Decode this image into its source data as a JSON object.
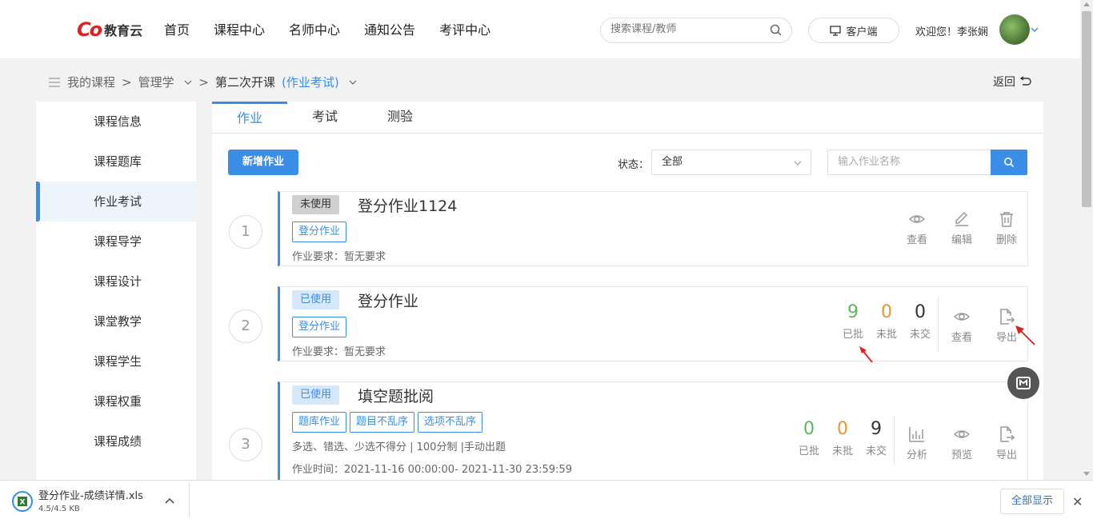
{
  "header": {
    "logo_mark": "Co",
    "logo_text": "教育云",
    "nav": [
      "首页",
      "课程中心",
      "名师中心",
      "通知公告",
      "考评中心"
    ],
    "search_placeholder": "搜索课程/教师",
    "client_label": "客户端",
    "welcome": "欢迎您！李张娴"
  },
  "breadcrumb": {
    "root": "我的课程",
    "sep": ">",
    "course": "管理学",
    "current_prefix": "第二次开课",
    "current_highlight": "(作业考试)"
  },
  "back_label": "返回",
  "sidebar": {
    "items": [
      "课程信息",
      "课程题库",
      "作业考试",
      "课程导学",
      "课程设计",
      "课堂教学",
      "课程学生",
      "课程权重",
      "课程成绩"
    ],
    "active_index": 2
  },
  "tabs": [
    "作业",
    "考试",
    "测验"
  ],
  "toolbar": {
    "add_label": "新增作业",
    "status_label": "状态：",
    "status_value": "全部",
    "name_placeholder": "输入作业名称"
  },
  "assignments": [
    {
      "num": "1",
      "status": "未使用",
      "title": "登分作业1124",
      "tags": [
        "登分作业"
      ],
      "requirement": "作业要求：暂无要求",
      "actions": [
        "查看",
        "编辑",
        "删除"
      ]
    },
    {
      "num": "2",
      "status": "已使用",
      "title": "登分作业",
      "tags": [
        "登分作业"
      ],
      "requirement": "作业要求：暂无要求",
      "stats": [
        {
          "n": "9",
          "label": "已批",
          "color": "#5cb85c"
        },
        {
          "n": "0",
          "label": "未批",
          "color": "#e6962e"
        },
        {
          "n": "0",
          "label": "未交",
          "color": "#333333"
        }
      ],
      "actions": [
        "查看",
        "导出"
      ]
    },
    {
      "num": "3",
      "status": "已使用",
      "title": "填空题批阅",
      "tags": [
        "题库作业",
        "题目不乱序",
        "选项不乱序"
      ],
      "info": "多选、错选、少选不得分 | 100分制 |手动出题",
      "time": "作业时间：2021-11-16 00:00:00- 2021-11-30 23:59:59",
      "stats": [
        {
          "n": "0",
          "label": "已批",
          "color": "#5cb85c"
        },
        {
          "n": "0",
          "label": "未批",
          "color": "#e6962e"
        },
        {
          "n": "9",
          "label": "未交",
          "color": "#333333"
        }
      ],
      "actions": [
        "分析",
        "预览",
        "导出"
      ]
    }
  ],
  "downloads": {
    "file_name": "登分作业-成绩详情.xls",
    "file_size": "4.5/4.5 KB",
    "show_all": "全部显示",
    "close": "✕"
  },
  "colors": {
    "accent": "#3a8ee6",
    "approved": "#5cb85c",
    "pending": "#e6962e",
    "annotation_arrow": "#e02020"
  }
}
